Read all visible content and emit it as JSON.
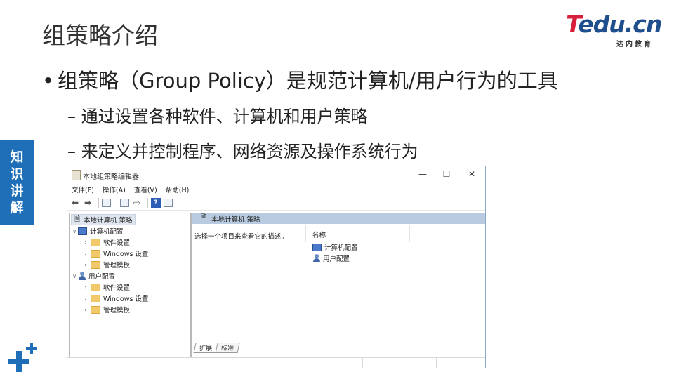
{
  "slide": {
    "title": "组策略介绍",
    "logo_text": "Tedu.cn",
    "logo_sub": "达内教育",
    "bullet": "组策略（Group Policy）是规范计算机/用户行为的工具",
    "sub1": "– 通过设置各种软件、计算机和用户策略",
    "sub2": "– 来定义并控制程序、网络资源及操作系统行为",
    "side_tag": [
      "知",
      "识",
      "讲",
      "解"
    ],
    "brand_color": "#1f6fb8"
  },
  "window": {
    "title": "本地组策略编辑器",
    "minimize": "—",
    "maximize": "☐",
    "close": "✕",
    "menu": [
      "文件(F)",
      "操作(A)",
      "查看(V)",
      "帮助(H)"
    ],
    "tree": {
      "root": "本地计算机 策略",
      "computer": "计算机配置",
      "computer_children": [
        "软件设置",
        "Windows 设置",
        "管理模板"
      ],
      "user": "用户配置",
      "user_children": [
        "软件设置",
        "Windows 设置",
        "管理模板"
      ]
    },
    "right": {
      "header": "本地计算机 策略",
      "description": "选择一个项目来查看它的描述。",
      "column_name": "名称",
      "items": [
        "计算机配置",
        "用户配置"
      ],
      "tabs": [
        "扩展",
        "标准"
      ]
    }
  }
}
